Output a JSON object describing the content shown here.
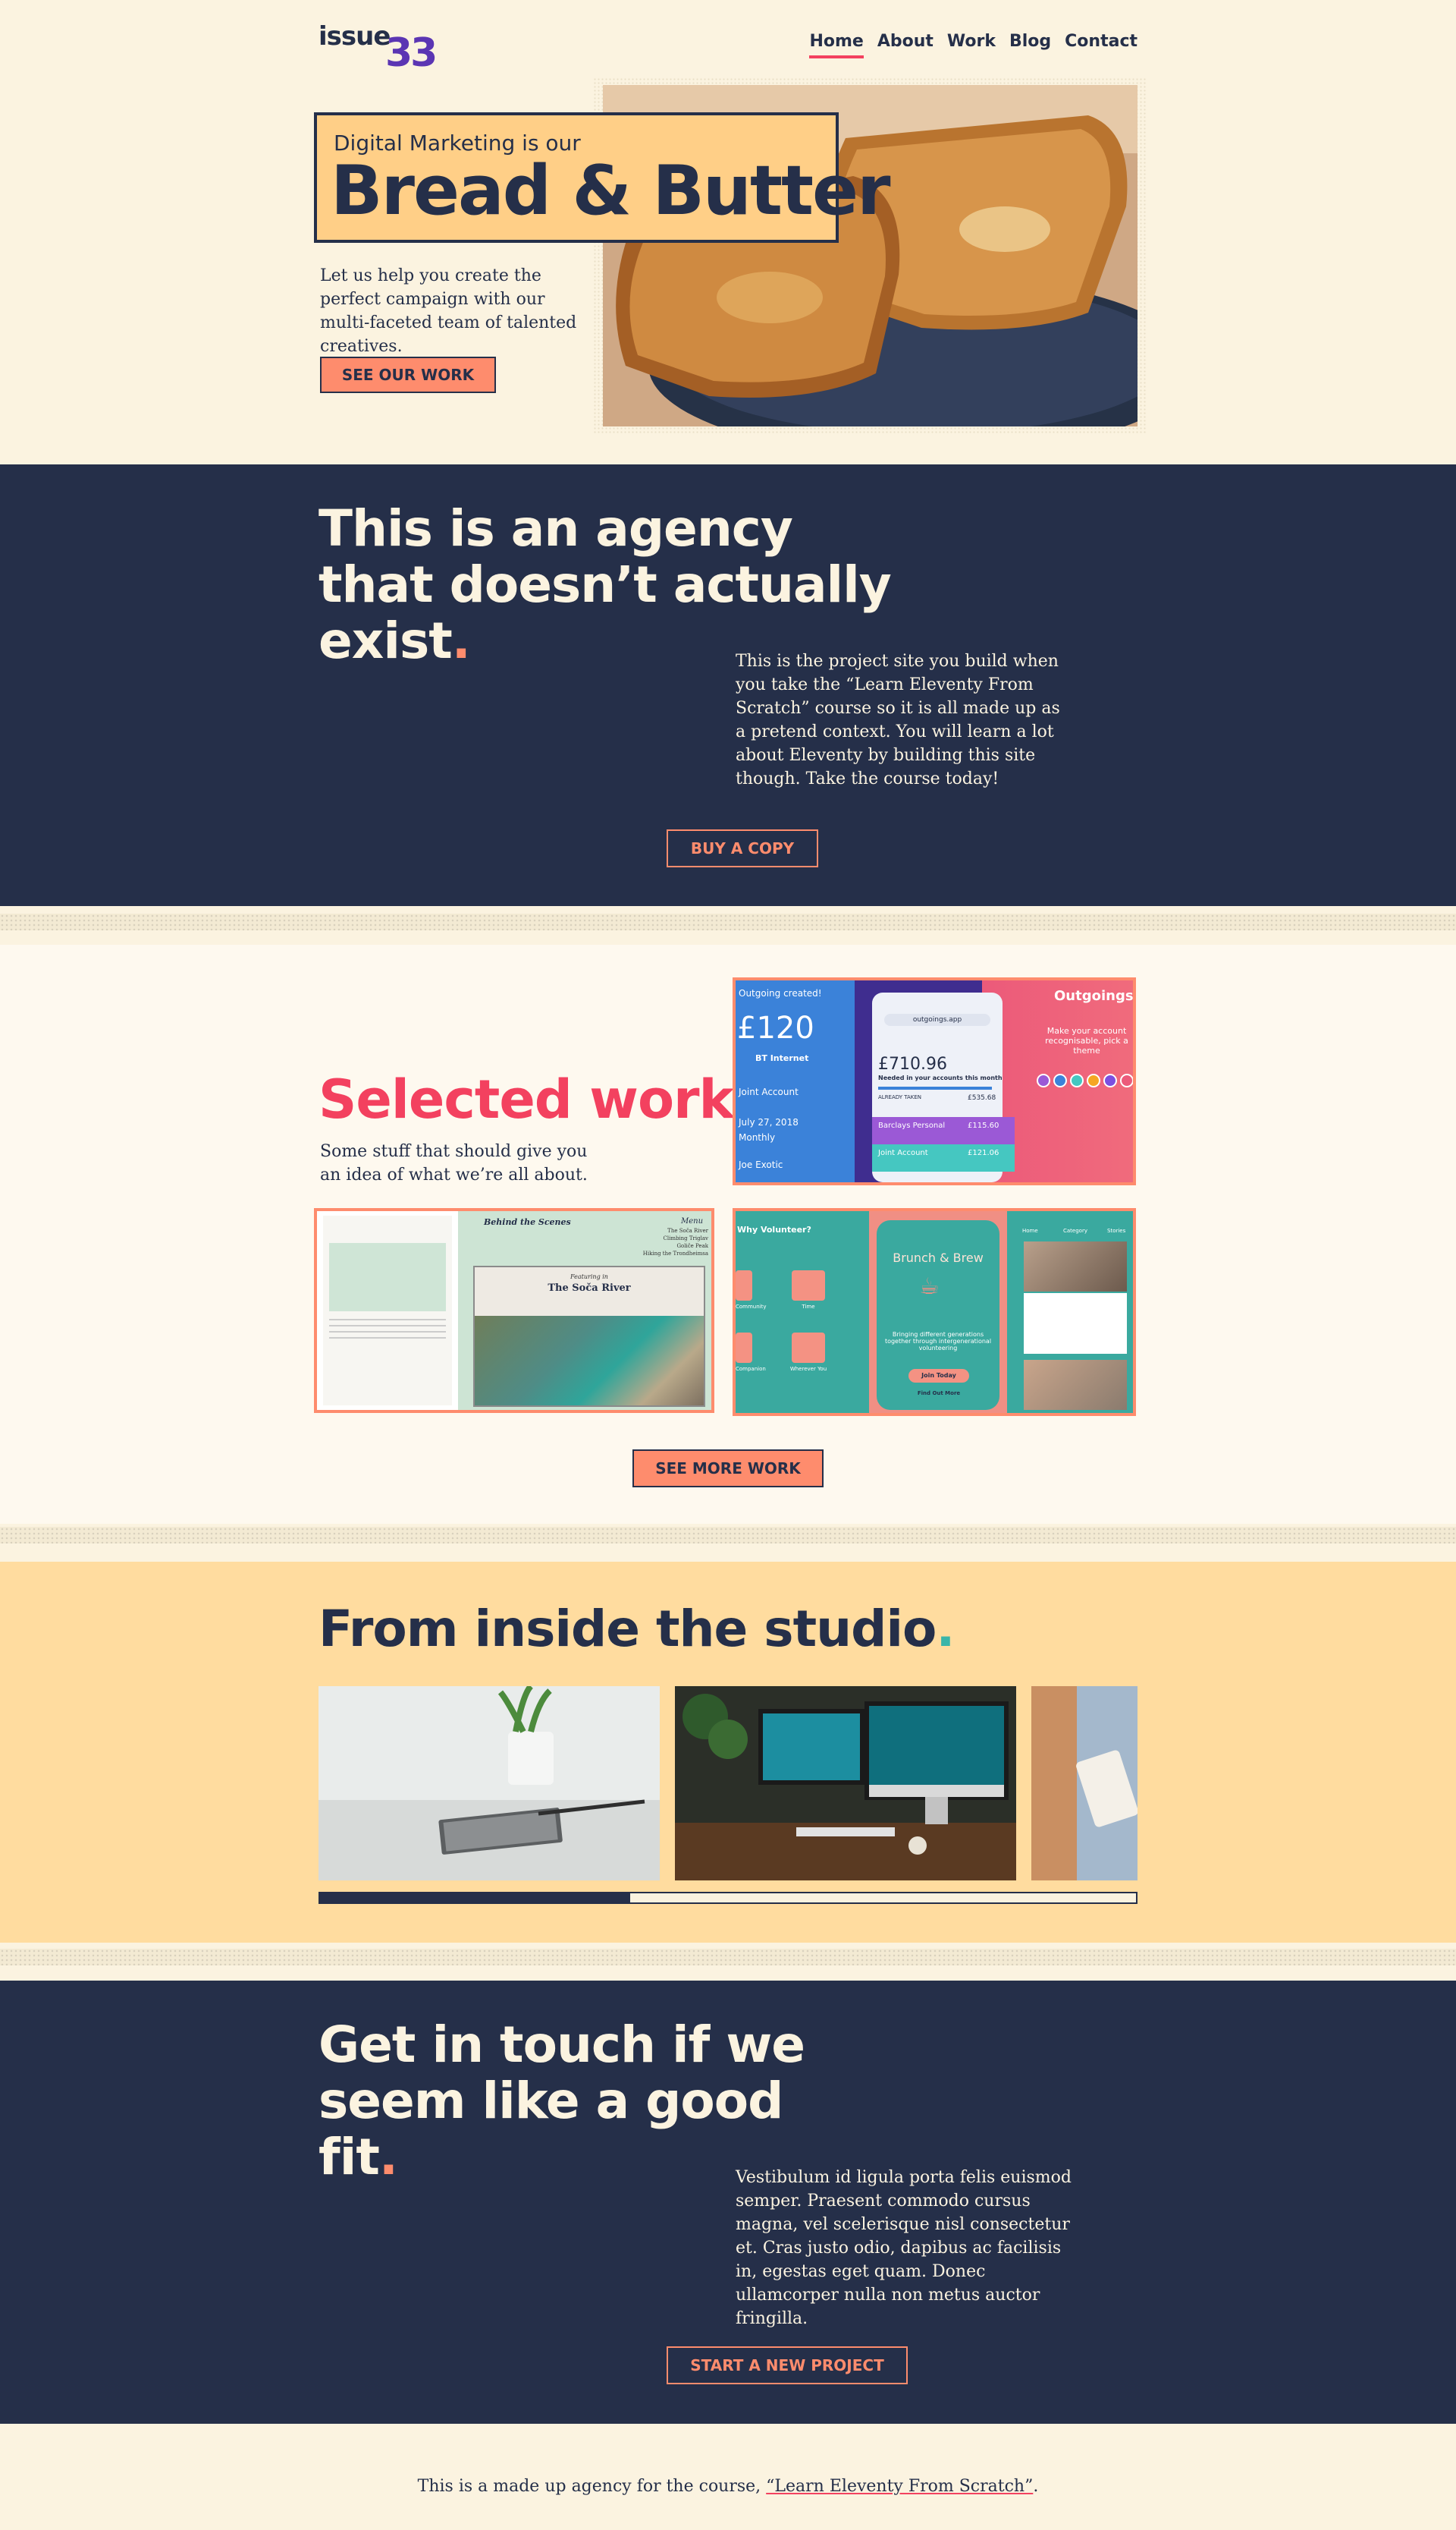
{
  "header": {
    "logo_word": "issue",
    "logo_number": "33",
    "nav": [
      "Home",
      "About",
      "Work",
      "Blog",
      "Contact"
    ],
    "active_nav": "Home"
  },
  "hero": {
    "kicker": "Digital Marketing is our",
    "title": "Bread & Butter",
    "intro": "Let us help you create the perfect campaign with our multi-faceted team of talented creatives.",
    "cta": "SEE OUR WORK",
    "image": "toast-photo"
  },
  "about": {
    "title": "This is an agency that doesn’t actually exist",
    "title_dot": ".",
    "text": "This is the project site you build when you take the “Learn Eleventy From Scratch” course so it is all made up as a pretend context. You will learn a lot about Eleventy by building this site though. Take the course today!",
    "cta": "BUY A COPY"
  },
  "work": {
    "title": "Selected work",
    "title_dot": ".",
    "intro": "Some stuff that should give you an idea of what we’re all about.",
    "cta": "SEE MORE WORK",
    "projects": [
      {
        "id": "outgoings",
        "brand": "Outgoings",
        "line1": "Outgoing created!",
        "amount1": "£120",
        "merchant": "BT Internet",
        "url": "outgoings.app",
        "balance": "£710.96",
        "balance_caption": "Needed in your accounts this month",
        "already_taken": "ALREADY TAKEN",
        "already_value": "£535.68",
        "item1_name": "Barclays Personal",
        "item1_value": "£115.60",
        "item2_name": "Joint Account",
        "item2_value": "£121.06",
        "date": "July 27, 2018",
        "cta_text": "Make your account recognisable, pick a theme",
        "left_labels": [
          "Joint Account",
          "Monthly",
          "Joe Exotic"
        ]
      },
      {
        "id": "behind-the-scenes",
        "heading": "Behind the Scenes",
        "menu": "Menu",
        "menu_items": [
          "The Soča River",
          "Climbing Triglav",
          "Goliče Peak",
          "Hiking the Trondheimsa"
        ],
        "feature_kicker": "Featuring in",
        "feature_title": "The Soča River"
      },
      {
        "id": "brunch-and-brew",
        "heading": "Why Volunteer?",
        "brand": "Brunch & Brew",
        "tagline": "Bringing different generations together through intergenerational volunteering",
        "cta": "Join Today",
        "link": "Find Out More",
        "tiles": [
          "Community",
          "Time",
          "Companion",
          "Wherever You"
        ],
        "tabs": [
          "Home",
          "Category",
          "Stories"
        ]
      }
    ]
  },
  "studio": {
    "title": "From inside the studio",
    "title_dot": ".",
    "photos": [
      "notebook-desk-photo",
      "imac-workspace-photo",
      "tablet-hands-photo"
    ],
    "scroll_progress": 0.38
  },
  "contact": {
    "title": "Get in touch if we seem like a good fit",
    "title_dot": ".",
    "text": "Vestibulum id ligula porta felis euismod semper. Praesent commodo cursus magna, vel scelerisque nisl consectetur et. Cras justo odio, dapibus ac facilisis in, egestas eget quam. Donec ullamcorper nulla non metus auctor fringilla.",
    "cta": "START A NEW PROJECT"
  },
  "footer": {
    "text_before": "This is a made up agency for the course, ",
    "link": "“Learn Eleventy From Scratch”",
    "text_after": "."
  },
  "colors": {
    "cream": "#fbf3e0",
    "navy": "#252f49",
    "coral": "#fe8c6d",
    "pink": "#f3415f",
    "butter": "#ffcf87",
    "studio_bg": "#ffdc9f",
    "purple": "#5b35b3",
    "teal": "#3ab5a9"
  }
}
